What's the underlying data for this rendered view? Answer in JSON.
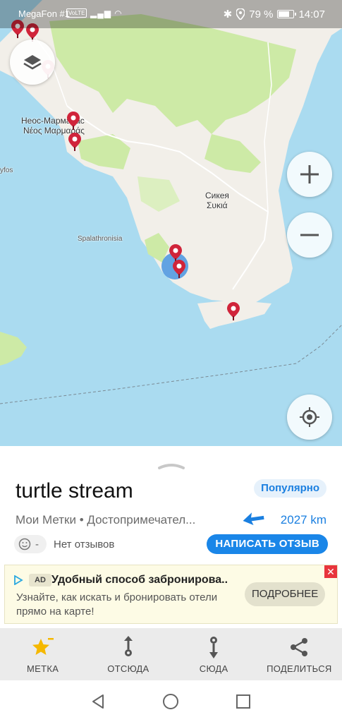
{
  "status_bar": {
    "carrier": "MegaFon #1",
    "volte": "VoLTE",
    "battery_percent": "79 %",
    "battery_level": 0.79,
    "time": "14:07"
  },
  "map": {
    "labels": {
      "neos_cyr": "Неос-Мармарас",
      "neos_greek": "Νέος Μαρμαράς",
      "sikeya_cyr": "Сикея",
      "sikeya_greek": "Συκιά",
      "spalathronisia": "Spalathronisia",
      "kyfos": "yfos"
    },
    "icons": {
      "layers": "layers-icon",
      "zoom_in": "plus-icon",
      "zoom_out": "minus-icon",
      "locate": "crosshair-icon",
      "pin": "map-pin-icon"
    },
    "colors": {
      "water": "#aadbf0",
      "land": "#f2efe9",
      "forest": "#cdeaa6",
      "pin": "#d0243a"
    }
  },
  "place": {
    "title": "turtle stream",
    "badge": "Популярно",
    "subtitle": "Мои Метки • Достопримечател...",
    "distance": "2027 km",
    "rating": "-",
    "reviews": "Нет отзывов",
    "write_review": "НАПИСАТЬ ОТЗЫВ"
  },
  "ad": {
    "badge": "AD",
    "title": "Удобный способ забронирова...",
    "text": "Узнайте, как искать и бронировать отели прямо на карте!",
    "button": "ПОДРОБНЕЕ",
    "close": "✕"
  },
  "bottom_nav": [
    {
      "label": "МЕТКА",
      "icon": "star-icon"
    },
    {
      "label": "ОТСЮДА",
      "icon": "route-from-icon"
    },
    {
      "label": "СЮДА",
      "icon": "route-to-icon"
    },
    {
      "label": "ПОДЕЛИТЬСЯ",
      "icon": "share-icon"
    }
  ],
  "colors": {
    "accent": "#1a86e8",
    "accent_text": "#1a7fe0",
    "star": "#f5b800"
  }
}
